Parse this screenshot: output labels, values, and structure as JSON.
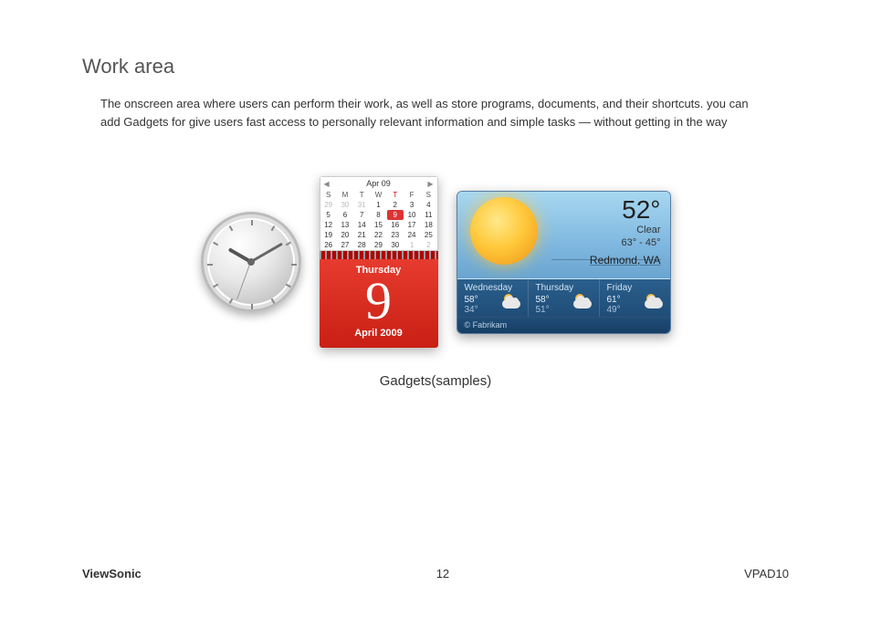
{
  "title": "Work area",
  "body": "The onscreen area where users can perform their work, as well as store programs, documents, and their shortcuts. you can add Gadgets for give users fast access to personally relevant information and simple tasks — without getting in the way",
  "caption": "Gadgets(samples)",
  "footer": {
    "brand": "ViewSonic",
    "page": "12",
    "model": "VPAD10"
  },
  "calendar": {
    "month_short": "Apr 09",
    "days_header": [
      "S",
      "M",
      "T",
      "W",
      "T",
      "F",
      "S"
    ],
    "weeks": [
      [
        {
          "n": "29",
          "dim": true
        },
        {
          "n": "30",
          "dim": true
        },
        {
          "n": "31",
          "dim": true
        },
        {
          "n": "1"
        },
        {
          "n": "2"
        },
        {
          "n": "3"
        },
        {
          "n": "4"
        }
      ],
      [
        {
          "n": "5"
        },
        {
          "n": "6"
        },
        {
          "n": "7"
        },
        {
          "n": "8"
        },
        {
          "n": "9",
          "today": true
        },
        {
          "n": "10"
        },
        {
          "n": "11"
        }
      ],
      [
        {
          "n": "12"
        },
        {
          "n": "13"
        },
        {
          "n": "14"
        },
        {
          "n": "15"
        },
        {
          "n": "16"
        },
        {
          "n": "17"
        },
        {
          "n": "18"
        }
      ],
      [
        {
          "n": "19"
        },
        {
          "n": "20"
        },
        {
          "n": "21"
        },
        {
          "n": "22"
        },
        {
          "n": "23"
        },
        {
          "n": "24"
        },
        {
          "n": "25"
        }
      ],
      [
        {
          "n": "26"
        },
        {
          "n": "27"
        },
        {
          "n": "28"
        },
        {
          "n": "29"
        },
        {
          "n": "30"
        },
        {
          "n": "1",
          "dim": true
        },
        {
          "n": "2",
          "dim": true
        }
      ]
    ],
    "dayname": "Thursday",
    "daynum": "9",
    "monthyear": "April 2009"
  },
  "weather": {
    "temp": "52°",
    "condition": "Clear",
    "range": "63°  -  45°",
    "location": "Redmond, WA",
    "forecast": [
      {
        "day": "Wednesday",
        "hi": "58°",
        "lo": "34°"
      },
      {
        "day": "Thursday",
        "hi": "58°",
        "lo": "51°"
      },
      {
        "day": "Friday",
        "hi": "61°",
        "lo": "49°"
      }
    ],
    "credit": "© Fabrikam"
  }
}
